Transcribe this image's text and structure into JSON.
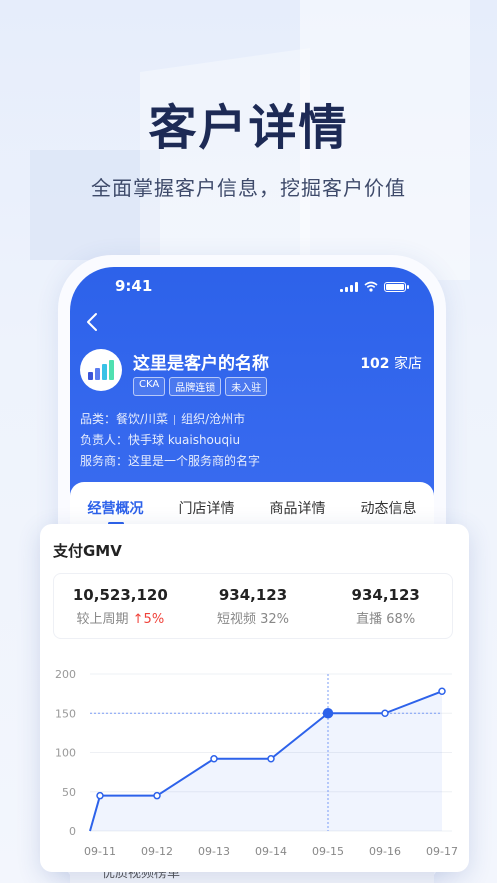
{
  "hero": {
    "title": "客户详情",
    "subtitle": "全面掌握客户信息，挖掘客户价值"
  },
  "status_bar": {
    "time": "9:41"
  },
  "customer": {
    "name": "这里是客户的名称",
    "store_count": "102",
    "store_unit": "家店",
    "tags": [
      "CKA",
      "品牌连锁",
      "未入驻"
    ],
    "category_label": "品类：",
    "category": "餐饮/川菜",
    "org": "组织/沧州市",
    "owner_label": "负责人：",
    "owner": "快手球 kuaishouqiu",
    "provider_label": "服务商：",
    "provider": "这里是一个服务商的名字"
  },
  "tabs": [
    "经营概况",
    "门店详情",
    "商品详情",
    "动态信息"
  ],
  "card": {
    "title": "支付GMV",
    "stats": [
      {
        "value": "10,523,120",
        "label": "较上周期",
        "delta": "5%"
      },
      {
        "value": "934,123",
        "label": "短视频 32%"
      },
      {
        "value": "934,123",
        "label": "直播 68%"
      }
    ]
  },
  "below_text": "优质视频榜单",
  "colors": {
    "primary": "#2d62ea",
    "up": "#f0423a"
  },
  "chart_data": {
    "type": "line",
    "categories": [
      "09-11",
      "09-12",
      "09-13",
      "09-14",
      "09-15",
      "09-16",
      "09-17"
    ],
    "x": [
      "09-11",
      "09-11",
      "09-12",
      "09-13",
      "09-14",
      "09-15",
      "09-16",
      "09-17"
    ],
    "values": [
      0,
      45,
      45,
      92,
      92,
      150,
      150,
      178
    ],
    "y_ticks": [
      0,
      50,
      100,
      150,
      200
    ],
    "ylim": [
      0,
      200
    ],
    "highlight": {
      "x": "09-15",
      "y": 150
    },
    "grid": true
  }
}
